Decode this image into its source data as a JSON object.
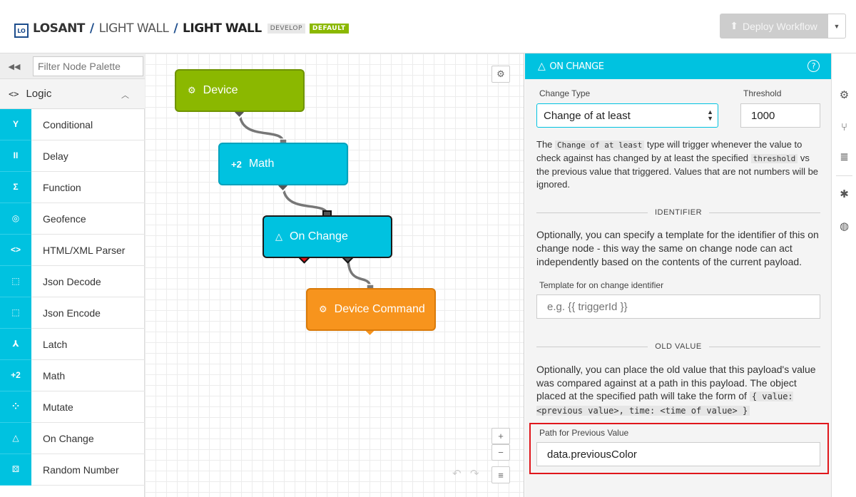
{
  "header": {
    "logo_text": "LO",
    "breadcrumbs": [
      "LOSANT",
      "LIGHT WALL",
      "LIGHT WALL"
    ],
    "tag_develop": "DEVELOP",
    "tag_default": "DEFAULT",
    "deploy_label": "Deploy Workflow",
    "deploy_caret": "▼"
  },
  "palette": {
    "collapse_icon": "◀◀",
    "filter_placeholder": "Filter Node Palette",
    "category": {
      "icon": "<>",
      "label": "Logic",
      "chevron": "︿"
    },
    "items": [
      {
        "icon": "Y",
        "label": "Conditional"
      },
      {
        "icon": "II",
        "label": "Delay"
      },
      {
        "icon": "Σ",
        "label": "Function"
      },
      {
        "icon": "◎",
        "label": "Geofence"
      },
      {
        "icon": "<>",
        "label": "HTML/XML Parser"
      },
      {
        "icon": "⬚",
        "label": "Json Decode"
      },
      {
        "icon": "⬚",
        "label": "Json Encode"
      },
      {
        "icon": "⅄",
        "label": "Latch"
      },
      {
        "icon": "+2",
        "label": "Math"
      },
      {
        "icon": "⁘",
        "label": "Mutate"
      },
      {
        "icon": "△",
        "label": "On Change"
      },
      {
        "icon": "⚄",
        "label": "Random Number"
      }
    ]
  },
  "canvas": {
    "nodes": [
      {
        "icon": "⚙",
        "label": "Device"
      },
      {
        "icon": "+2",
        "label": "Math"
      },
      {
        "icon": "△",
        "label": "On Change"
      },
      {
        "icon": "⚙",
        "label": "Device Command"
      }
    ],
    "tools": {
      "settings": "⚙",
      "zoom_in": "+",
      "zoom_out": "−",
      "menu": "≡",
      "undo": "↶",
      "redo": "↷"
    }
  },
  "panel": {
    "title": "ON CHANGE",
    "title_icon": "△",
    "help_icon": "?",
    "change_type_label": "Change Type",
    "change_type_value": "Change of at least",
    "threshold_label": "Threshold",
    "threshold_value": "1000",
    "desc1_a": "The ",
    "desc1_code1": "Change of at least",
    "desc1_b": " type will trigger whenever the value to check against has changed by at least the specified ",
    "desc1_code2": "threshold",
    "desc1_c": " vs the previous value that triggered. Values that are not numbers will be ignored.",
    "identifier_heading": "IDENTIFIER",
    "identifier_desc": "Optionally, you can specify a template for the identifier of this on change node - this way the same on change node can act independently based on the contents of the current payload.",
    "template_label": "Template for on change identifier",
    "template_placeholder": "e.g. {{ triggerId }}",
    "old_value_heading": "OLD VALUE",
    "old_value_desc_a": "Optionally, you can place the old value that this payload's value was compared against at a path in this payload. The object placed at the specified path will take the form of ",
    "old_value_code": "{ value: <previous value>, time: <time of value> }",
    "path_label": "Path for Previous Value",
    "path_value": "data.previousColor"
  },
  "rightbar": {
    "icons": [
      "gear-icon",
      "branch-icon",
      "database-icon",
      "bug-icon",
      "globe-icon"
    ],
    "glyphs": [
      "⚙",
      "⑂",
      "≣",
      "✱",
      "◍"
    ]
  },
  "colors": {
    "accent": "#00c2e0",
    "device": "#8bb800",
    "command": "#f7941d",
    "highlight": "#e0161b"
  }
}
